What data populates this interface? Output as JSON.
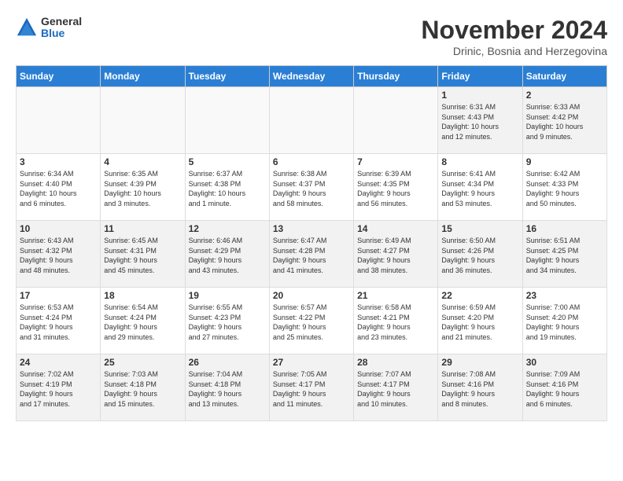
{
  "logo": {
    "general": "General",
    "blue": "Blue"
  },
  "title": "November 2024",
  "subtitle": "Drinic, Bosnia and Herzegovina",
  "days_of_week": [
    "Sunday",
    "Monday",
    "Tuesday",
    "Wednesday",
    "Thursday",
    "Friday",
    "Saturday"
  ],
  "weeks": [
    [
      {
        "day": "",
        "info": "",
        "empty": true
      },
      {
        "day": "",
        "info": "",
        "empty": true
      },
      {
        "day": "",
        "info": "",
        "empty": true
      },
      {
        "day": "",
        "info": "",
        "empty": true
      },
      {
        "day": "",
        "info": "",
        "empty": true
      },
      {
        "day": "1",
        "info": "Sunrise: 6:31 AM\nSunset: 4:43 PM\nDaylight: 10 hours\nand 12 minutes."
      },
      {
        "day": "2",
        "info": "Sunrise: 6:33 AM\nSunset: 4:42 PM\nDaylight: 10 hours\nand 9 minutes."
      }
    ],
    [
      {
        "day": "3",
        "info": "Sunrise: 6:34 AM\nSunset: 4:40 PM\nDaylight: 10 hours\nand 6 minutes."
      },
      {
        "day": "4",
        "info": "Sunrise: 6:35 AM\nSunset: 4:39 PM\nDaylight: 10 hours\nand 3 minutes."
      },
      {
        "day": "5",
        "info": "Sunrise: 6:37 AM\nSunset: 4:38 PM\nDaylight: 10 hours\nand 1 minute."
      },
      {
        "day": "6",
        "info": "Sunrise: 6:38 AM\nSunset: 4:37 PM\nDaylight: 9 hours\nand 58 minutes."
      },
      {
        "day": "7",
        "info": "Sunrise: 6:39 AM\nSunset: 4:35 PM\nDaylight: 9 hours\nand 56 minutes."
      },
      {
        "day": "8",
        "info": "Sunrise: 6:41 AM\nSunset: 4:34 PM\nDaylight: 9 hours\nand 53 minutes."
      },
      {
        "day": "9",
        "info": "Sunrise: 6:42 AM\nSunset: 4:33 PM\nDaylight: 9 hours\nand 50 minutes."
      }
    ],
    [
      {
        "day": "10",
        "info": "Sunrise: 6:43 AM\nSunset: 4:32 PM\nDaylight: 9 hours\nand 48 minutes."
      },
      {
        "day": "11",
        "info": "Sunrise: 6:45 AM\nSunset: 4:31 PM\nDaylight: 9 hours\nand 45 minutes."
      },
      {
        "day": "12",
        "info": "Sunrise: 6:46 AM\nSunset: 4:29 PM\nDaylight: 9 hours\nand 43 minutes."
      },
      {
        "day": "13",
        "info": "Sunrise: 6:47 AM\nSunset: 4:28 PM\nDaylight: 9 hours\nand 41 minutes."
      },
      {
        "day": "14",
        "info": "Sunrise: 6:49 AM\nSunset: 4:27 PM\nDaylight: 9 hours\nand 38 minutes."
      },
      {
        "day": "15",
        "info": "Sunrise: 6:50 AM\nSunset: 4:26 PM\nDaylight: 9 hours\nand 36 minutes."
      },
      {
        "day": "16",
        "info": "Sunrise: 6:51 AM\nSunset: 4:25 PM\nDaylight: 9 hours\nand 34 minutes."
      }
    ],
    [
      {
        "day": "17",
        "info": "Sunrise: 6:53 AM\nSunset: 4:24 PM\nDaylight: 9 hours\nand 31 minutes."
      },
      {
        "day": "18",
        "info": "Sunrise: 6:54 AM\nSunset: 4:24 PM\nDaylight: 9 hours\nand 29 minutes."
      },
      {
        "day": "19",
        "info": "Sunrise: 6:55 AM\nSunset: 4:23 PM\nDaylight: 9 hours\nand 27 minutes."
      },
      {
        "day": "20",
        "info": "Sunrise: 6:57 AM\nSunset: 4:22 PM\nDaylight: 9 hours\nand 25 minutes."
      },
      {
        "day": "21",
        "info": "Sunrise: 6:58 AM\nSunset: 4:21 PM\nDaylight: 9 hours\nand 23 minutes."
      },
      {
        "day": "22",
        "info": "Sunrise: 6:59 AM\nSunset: 4:20 PM\nDaylight: 9 hours\nand 21 minutes."
      },
      {
        "day": "23",
        "info": "Sunrise: 7:00 AM\nSunset: 4:20 PM\nDaylight: 9 hours\nand 19 minutes."
      }
    ],
    [
      {
        "day": "24",
        "info": "Sunrise: 7:02 AM\nSunset: 4:19 PM\nDaylight: 9 hours\nand 17 minutes."
      },
      {
        "day": "25",
        "info": "Sunrise: 7:03 AM\nSunset: 4:18 PM\nDaylight: 9 hours\nand 15 minutes."
      },
      {
        "day": "26",
        "info": "Sunrise: 7:04 AM\nSunset: 4:18 PM\nDaylight: 9 hours\nand 13 minutes."
      },
      {
        "day": "27",
        "info": "Sunrise: 7:05 AM\nSunset: 4:17 PM\nDaylight: 9 hours\nand 11 minutes."
      },
      {
        "day": "28",
        "info": "Sunrise: 7:07 AM\nSunset: 4:17 PM\nDaylight: 9 hours\nand 10 minutes."
      },
      {
        "day": "29",
        "info": "Sunrise: 7:08 AM\nSunset: 4:16 PM\nDaylight: 9 hours\nand 8 minutes."
      },
      {
        "day": "30",
        "info": "Sunrise: 7:09 AM\nSunset: 4:16 PM\nDaylight: 9 hours\nand 6 minutes."
      }
    ]
  ]
}
